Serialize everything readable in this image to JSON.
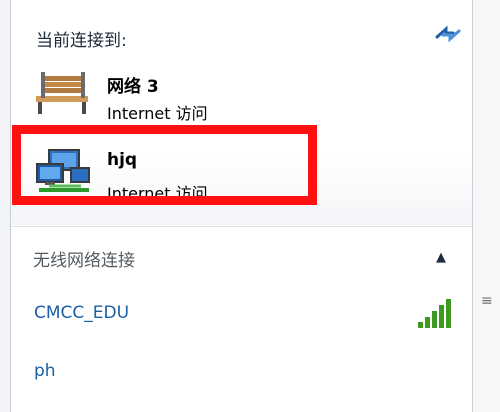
{
  "connected": {
    "title": "当前连接到:",
    "networks": [
      {
        "name": "网络  3",
        "access": "Internet 访问",
        "icon": "bench-icon"
      },
      {
        "name": "hjq",
        "access": "Internet 访问",
        "icon": "network-computers-icon"
      }
    ]
  },
  "wireless": {
    "title": "无线网络连接",
    "networks": [
      {
        "name": "CMCC_EDU",
        "signal_bars": 5
      },
      {
        "name": "ph"
      }
    ]
  },
  "colors": {
    "highlight": "#ff1111",
    "link": "#1b5fa6",
    "signal": "#3c9a1f"
  }
}
